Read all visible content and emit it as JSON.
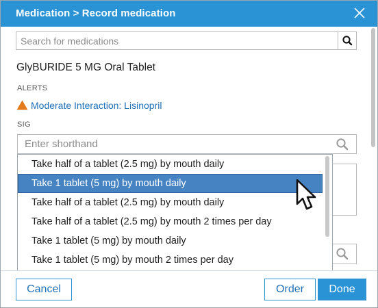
{
  "dialog": {
    "title": "Medication > Record medication",
    "close_icon": "close-icon"
  },
  "search": {
    "placeholder": "Search for medications",
    "value": "",
    "icon": "search-icon"
  },
  "medication": {
    "name": "GlyBURIDE 5 MG Oral Tablet"
  },
  "alerts": {
    "label": "ALERTS",
    "icon": "warning-triangle-icon",
    "icon_color": "#e2791b",
    "link_text": "Moderate Interaction: Lisinopril"
  },
  "sig": {
    "label": "SIG",
    "placeholder": "Enter shorthand",
    "value": "",
    "icon": "search-icon"
  },
  "dropdown": {
    "options": [
      "Take half of a tablet (2.5 mg) by mouth daily",
      "Take 1 tablet (5 mg) by mouth daily",
      "Take half of a tablet (2.5 mg) by mouth daily",
      "Take half of a tablet (2.5 mg) by mouth 2 times per day",
      "Take 1 tablet (5 mg) by mouth daily",
      "Take 1 tablet (5 mg) by mouth 2 times per day"
    ],
    "selected_index": 1
  },
  "footer": {
    "cancel_label": "Cancel",
    "order_label": "Order",
    "done_label": "Done"
  },
  "colors": {
    "accent": "#2a93d5",
    "link": "#1f6fb8",
    "selected_row": "#4683c2",
    "warning": "#e2791b"
  }
}
